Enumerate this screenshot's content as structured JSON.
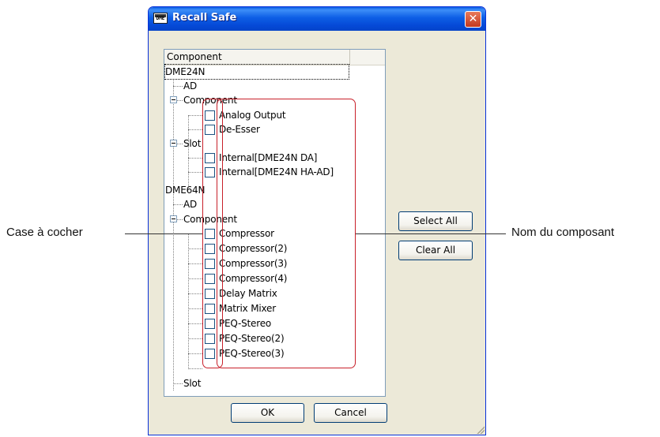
{
  "window": {
    "title": "Recall Safe",
    "app_icon_text": "DME"
  },
  "tree": {
    "column_header": "Component",
    "nodes": [
      {
        "label": "DME24N"
      },
      {
        "label": "AD"
      },
      {
        "label": "Component"
      },
      {
        "label": "Analog Output",
        "checked": false
      },
      {
        "label": "De-Esser",
        "checked": false
      },
      {
        "label": "Slot"
      },
      {
        "label": "Internal[DME24N DA]",
        "checked": false
      },
      {
        "label": "Internal[DME24N HA-AD]",
        "checked": false
      },
      {
        "label": "DME64N"
      },
      {
        "label": "AD"
      },
      {
        "label": "Component"
      },
      {
        "label": "Compressor",
        "checked": false
      },
      {
        "label": "Compressor(2)",
        "checked": false
      },
      {
        "label": "Compressor(3)",
        "checked": false
      },
      {
        "label": "Compressor(4)",
        "checked": false
      },
      {
        "label": "Delay Matrix",
        "checked": false
      },
      {
        "label": "Matrix Mixer",
        "checked": false
      },
      {
        "label": "PEQ-Stereo",
        "checked": false
      },
      {
        "label": "PEQ-Stereo(2)",
        "checked": false
      },
      {
        "label": "PEQ-Stereo(3)",
        "checked": false
      },
      {
        "label": "Slot"
      }
    ]
  },
  "buttons": {
    "select_all": "Select All",
    "clear_all": "Clear All",
    "ok": "OK",
    "cancel": "Cancel"
  },
  "annotations": {
    "left": "Case à cocher",
    "right": "Nom du composant"
  },
  "colors": {
    "callout": "#c8202a",
    "titlebar": "#0548d6"
  }
}
